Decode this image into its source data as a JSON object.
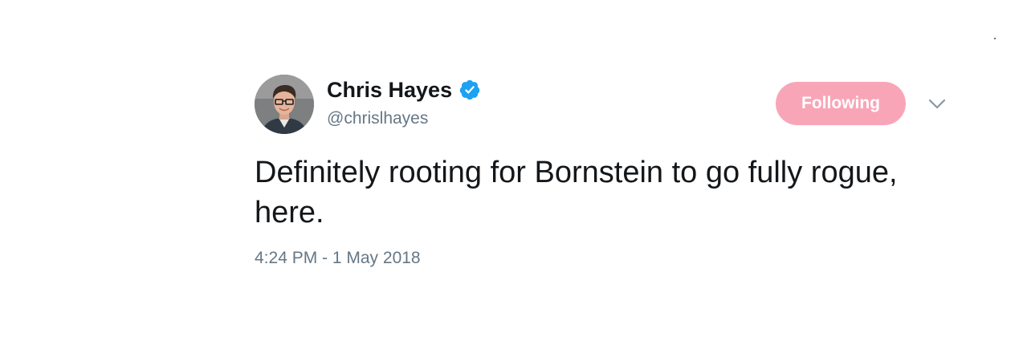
{
  "author": {
    "name": "Chris Hayes",
    "handle": "@chrislhayes",
    "verified": true,
    "verified_color": "#1da1f2"
  },
  "follow_button": {
    "label": "Following",
    "color": "#f8a6b7"
  },
  "tweet": {
    "text": "Definitely rooting for Bornstein to go fully rogue, here.",
    "timestamp": "4:24 PM - 1 May 2018"
  },
  "icons": {
    "verified": "verified-badge-icon",
    "menu": "chevron-down-icon"
  },
  "colors": {
    "text_primary": "#14171a",
    "text_secondary": "#657786",
    "background": "#ffffff"
  }
}
